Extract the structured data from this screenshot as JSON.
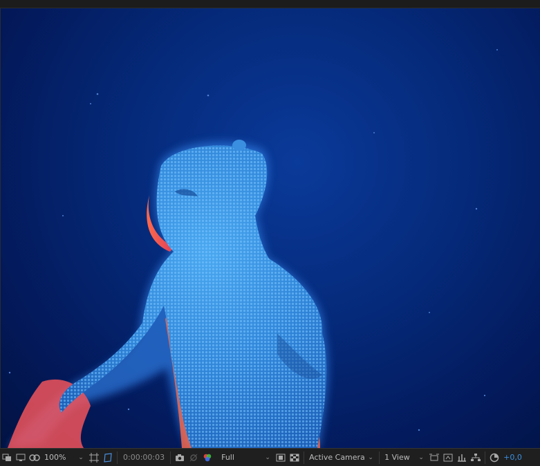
{
  "viewer": {
    "description_icons": [
      "particle-figure"
    ]
  },
  "toolbar": {
    "magnification": "100%",
    "timecode": "0:00:00:03",
    "resolution": "Full",
    "camera": "Active Camera",
    "views": "1 View",
    "exposure": "+0,0",
    "icons": [
      "always-preview-icon",
      "monitor-icon",
      "mask-visibility-icon",
      "grid-guides-icon",
      "region-of-interest-icon",
      "snapshot-icon",
      "show-snapshot-icon",
      "channel-icon",
      "fast-previews-icon",
      "transparency-grid-icon",
      "3d-renderer-icon",
      "reset-view-icon",
      "flowchart-icon",
      "reset-exposure-icon"
    ],
    "accent_color": "#3b8fe0"
  }
}
